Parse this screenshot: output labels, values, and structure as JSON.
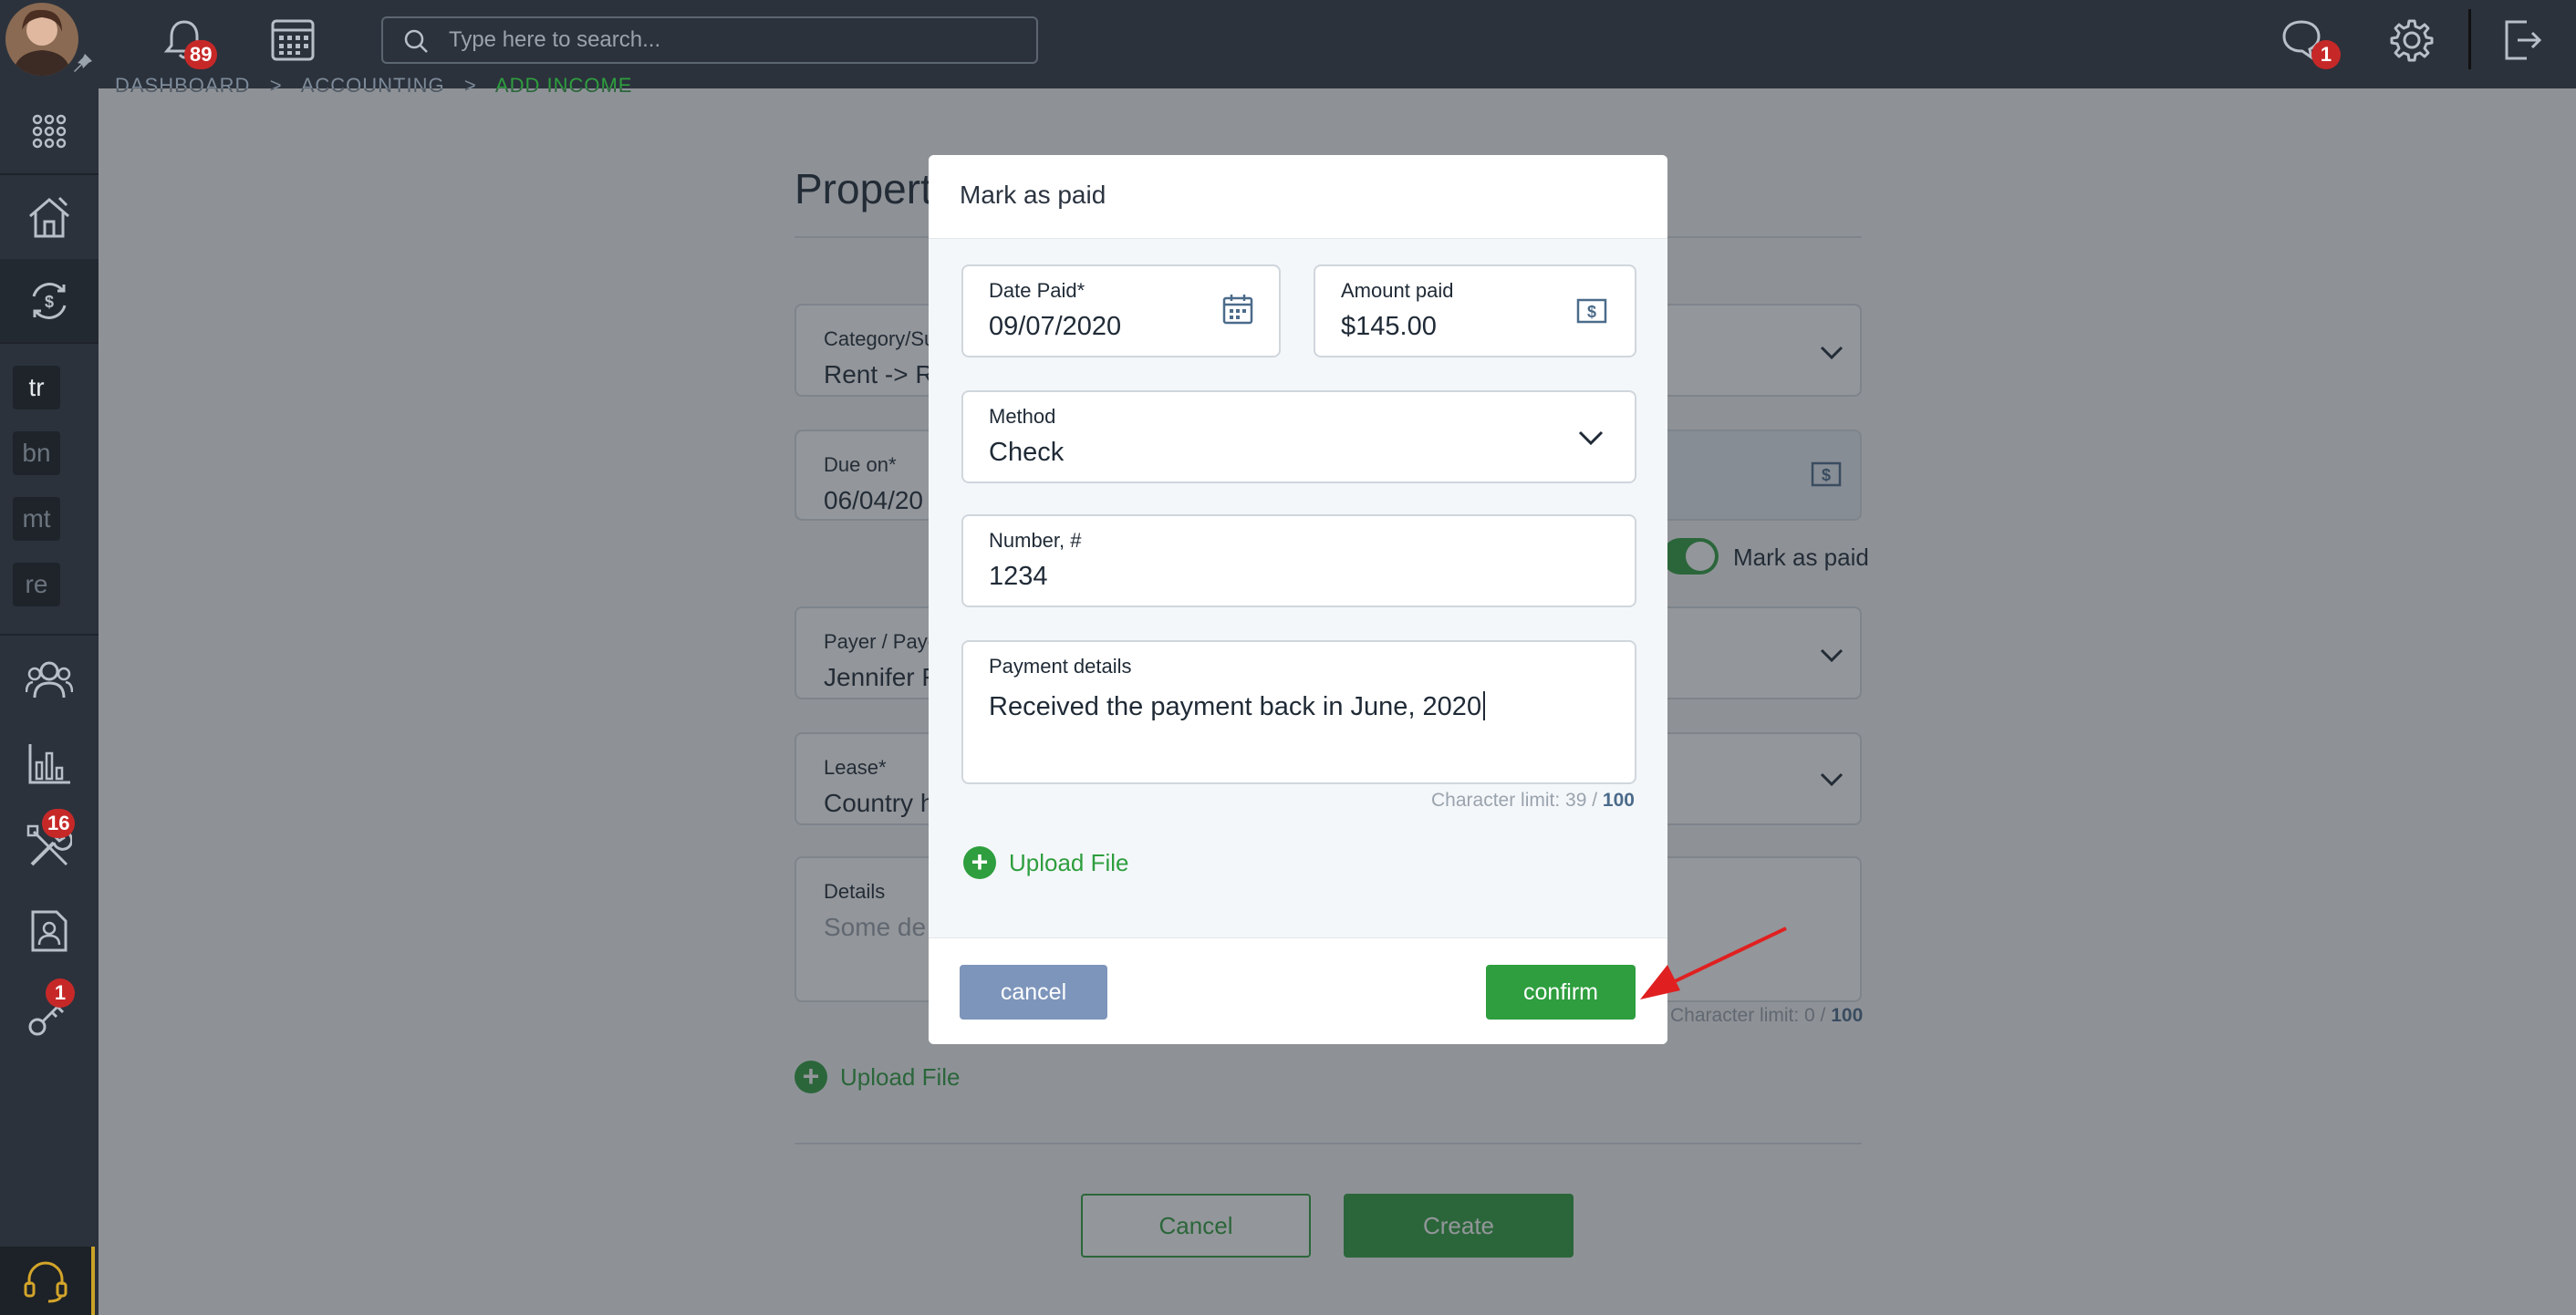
{
  "header": {
    "notifications_count": "89",
    "search_placeholder": "Type here to search...",
    "messages_count": "1"
  },
  "sidebar": {
    "abbreviations": [
      "tr",
      "bn",
      "mt",
      "re"
    ],
    "tools_badge": "16",
    "keys_badge": "1"
  },
  "page": {
    "breadcrumb": [
      "DASHBOARD",
      "ACCOUNTING",
      "ADD INCOME"
    ],
    "breadcrumb_sep": ">",
    "title": "Propert",
    "category": {
      "label": "Category/Su",
      "value": "Rent -> Re"
    },
    "due_on": {
      "label": "Due on*",
      "value": "06/04/20"
    },
    "toggle_label": "Mark as paid",
    "payer": {
      "label": "Payer / Paye",
      "value": "Jennifer F"
    },
    "lease": {
      "label": "Lease*",
      "value": "Country h"
    },
    "details": {
      "label": "Details",
      "placeholder": "Some de"
    },
    "details_limit": {
      "text": "Character limit: 0 /",
      "max": "100"
    },
    "upload_label": "Upload File",
    "cancel_label": "Cancel",
    "create_label": "Create"
  },
  "modal": {
    "title": "Mark as paid",
    "date_paid": {
      "label": "Date Paid*",
      "value": "09/07/2020"
    },
    "amount_paid": {
      "label": "Amount paid",
      "value": "$145.00"
    },
    "method": {
      "label": "Method",
      "value": "Check"
    },
    "number": {
      "label": "Number, #",
      "value": "1234"
    },
    "payment_details": {
      "label": "Payment details",
      "value": "Received the payment back in June, 2020"
    },
    "char_limit": {
      "text": "Character limit: 39 /",
      "max": "100"
    },
    "upload_label": "Upload File",
    "cancel_label": "cancel",
    "confirm_label": "confirm"
  },
  "colors": {
    "accent_green": "#2e9e3e",
    "topbar": "#2b323c",
    "badge_red": "#c62828",
    "cancel_blue": "#7d95bb",
    "annotation_arrow": "#e02020"
  },
  "icons": [
    "bell-icon",
    "calendar-icon",
    "search-icon",
    "chat-icon",
    "gear-icon",
    "logout-icon",
    "apps-grid-icon",
    "property-icon",
    "accounting-icon",
    "people-icon",
    "reports-icon",
    "tools-icon",
    "document-icon",
    "keys-icon",
    "headset-icon",
    "dollar-icon",
    "chevron-down-icon",
    "plus-icon"
  ]
}
